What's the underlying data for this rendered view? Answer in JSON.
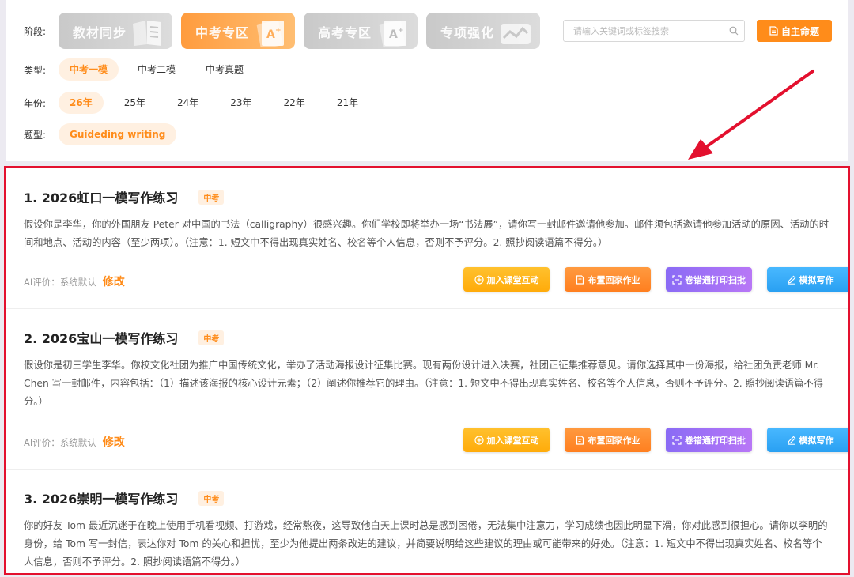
{
  "filters": {
    "stage": {
      "label": "阶段:",
      "options": [
        {
          "label": "教材同步",
          "active": false,
          "icon": "book-icon"
        },
        {
          "label": "中考专区",
          "active": true,
          "icon": "paper-a-icon"
        },
        {
          "label": "高考专区",
          "active": false,
          "icon": "paper-a-icon"
        },
        {
          "label": "专项强化",
          "active": false,
          "icon": "chart-wave-icon"
        }
      ]
    },
    "search": {
      "placeholder": "请输入关键词或标签搜索",
      "icon": "search-icon"
    },
    "custom_button": {
      "label": "自主命题",
      "icon": "document-icon"
    },
    "type": {
      "label": "类型:",
      "options": [
        "中考一模",
        "中考二模",
        "中考真题"
      ],
      "active": "中考一模"
    },
    "year": {
      "label": "年份:",
      "options": [
        "26年",
        "25年",
        "24年",
        "23年",
        "22年",
        "21年"
      ],
      "active": "26年"
    },
    "topic": {
      "label": "题型:",
      "options": [
        "Guideding writing"
      ],
      "active": "Guideding writing"
    }
  },
  "items": [
    {
      "title": "1. 2026虹口一模写作练习",
      "tag": "中考",
      "body": "假设你是李华，你的外国朋友 Peter 对中国的书法（calligraphy）很感兴趣。你们学校即将举办一场“书法展”，请你写一封邮件邀请他参加。邮件须包括邀请他参加活动的原因、活动的时间和地点、活动的内容（至少两项）。（注意：1. 短文中不得出现真实姓名、校名等个人信息，否则不予评分。2. 照抄阅读语篇不得分。）",
      "ai_label": "AI评价：系统默认",
      "modify": "修改"
    },
    {
      "title": "2. 2026宝山一模写作练习",
      "tag": "中考",
      "body": "假设你是初三学生李华。你校文化社团为推广中国传统文化，举办了活动海报设计征集比赛。现有两份设计进入决赛，社团正征集推荐意见。请你选择其中一份海报，给社团负责老师 Mr. Chen 写一封邮件，内容包括：（1）描述该海报的核心设计元素；（2）阐述你推荐它的理由。（注意：1. 短文中不得出现真实姓名、校名等个人信息，否则不予评分。2. 照抄阅读语篇不得分。）",
      "ai_label": "AI评价：系统默认",
      "modify": "修改"
    },
    {
      "title": "3. 2026崇明一模写作练习",
      "tag": "中考",
      "body": "你的好友 Tom 最近沉迷于在晚上使用手机看视频、打游戏，经常熬夜，这导致他白天上课时总是感到困倦，无法集中注意力，学习成绩也因此明显下滑，你对此感到很担心。请你以李明的身份，给 Tom 写一封信，表达你对 Tom 的关心和担忧，至少为他提出两条改进的建议，并简要说明给这些建议的理由或可能带来的好处。（注意：1. 短文中不得出现真实姓名、校名等个人信息，否则不予评分。2. 照抄阅读语篇不得分。）"
    }
  ],
  "actions": {
    "add_class": "加入课堂互动",
    "homework": "布置回家作业",
    "scan_print": "卷错通打印扫批",
    "simulate": "模拟写作"
  },
  "colors": {
    "accent": "#ff8c1a",
    "highlight_border": "#e3102e",
    "arrow": "#e3102e"
  }
}
